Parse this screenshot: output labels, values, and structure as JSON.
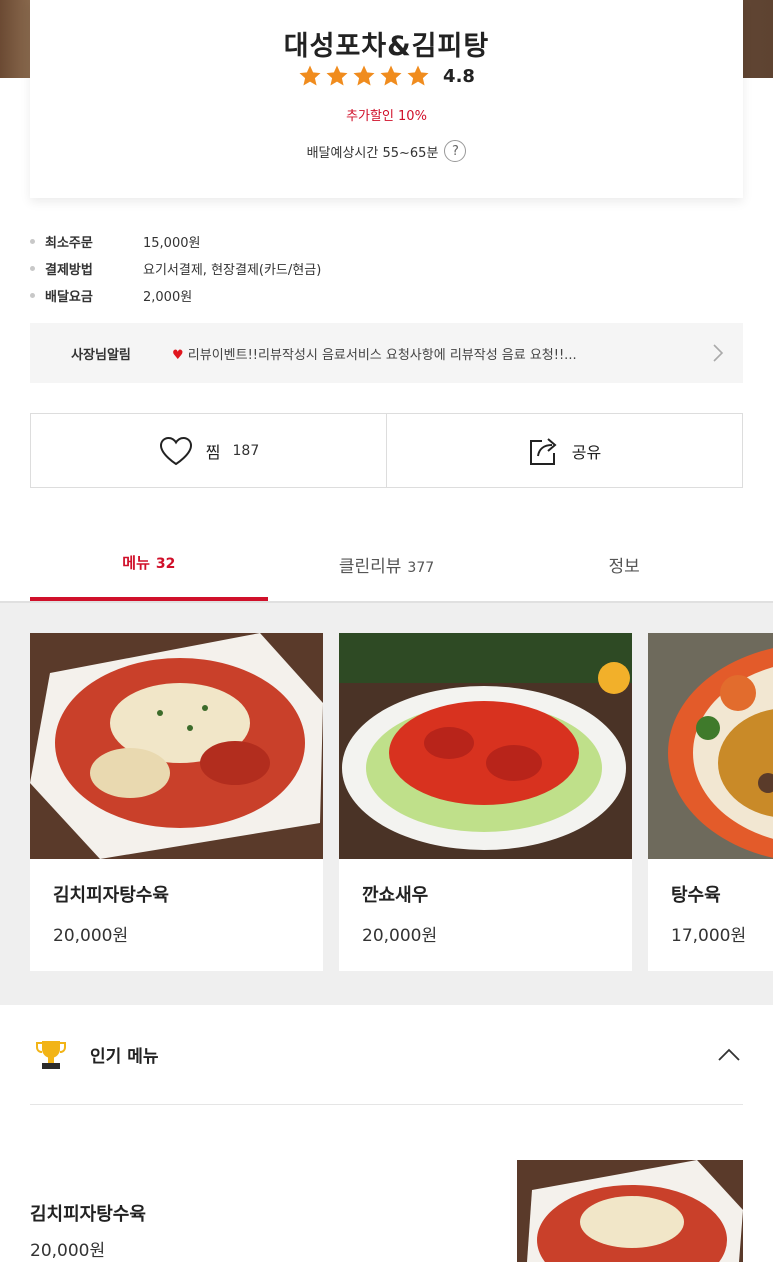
{
  "store": {
    "name": "대성포차&김피탕",
    "rating": "4.8",
    "rating_stars": 5,
    "discount": "추가할인 10%",
    "delivery_time": "배달예상시간 55~65분",
    "help_glyph": "?"
  },
  "info": [
    {
      "label": "최소주문",
      "value": "15,000원"
    },
    {
      "label": "결제방법",
      "value": "요기서결제, 현장결제(카드/현금)"
    },
    {
      "label": "배달요금",
      "value": "2,000원"
    }
  ],
  "notice": {
    "label": "사장님알림",
    "text": "리뷰이벤트!!리뷰작성시 음료서비스 요청사항에 리뷰작성 음료 요청!!..."
  },
  "actions": {
    "like_label": "찜",
    "like_count": "187",
    "share_label": "공유"
  },
  "tabs": [
    {
      "label": "메뉴",
      "count": "32",
      "active": true
    },
    {
      "label": "클린리뷰",
      "count": "377",
      "active": false
    },
    {
      "label": "정보",
      "count": "",
      "active": false
    }
  ],
  "menu_cards": [
    {
      "name": "김치피자탕수육",
      "price": "20,000원",
      "image": "kimchi-pizza-tangsuyuk"
    },
    {
      "name": "깐쇼새우",
      "price": "20,000원",
      "image": "kkanpung-shrimp"
    },
    {
      "name": "탕수육",
      "price": "17,000원",
      "image": "tangsuyuk"
    }
  ],
  "popular": {
    "title": "인기 메뉴",
    "items": [
      {
        "name": "김치피자탕수육",
        "price": "20,000원"
      }
    ]
  },
  "colors": {
    "accent": "#d0102a",
    "star": "#f08c1e",
    "carousel_bg": "#efefef"
  }
}
